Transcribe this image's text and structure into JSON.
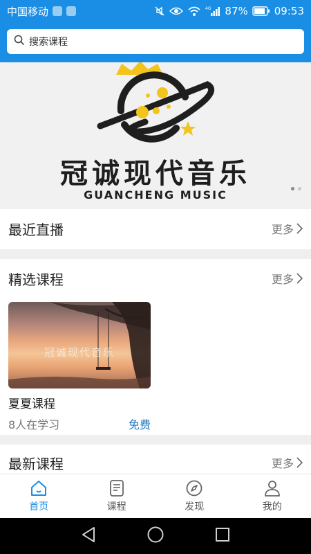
{
  "status_bar": {
    "carrier": "中国移动",
    "network": "4G",
    "battery": "87%",
    "time": "09:53"
  },
  "search": {
    "placeholder": "搜索课程"
  },
  "banner": {
    "title": "冠诚现代音乐",
    "subtitle": "GUANCHENG MUSIC",
    "page_indicator": {
      "count": 2,
      "active_index": 0
    }
  },
  "sections": {
    "live": {
      "title": "最近直播",
      "more": "更多"
    },
    "featured": {
      "title": "精选课程",
      "more": "更多",
      "courses": [
        {
          "thumb_text": "冠诚现代音乐",
          "title": "夏夏课程",
          "learners": "8人在学习",
          "price": "免费"
        }
      ]
    },
    "latest": {
      "title": "最新课程",
      "more": "更多"
    }
  },
  "tabbar": {
    "tabs": [
      {
        "label": "首页",
        "icon": "home-icon",
        "active": true
      },
      {
        "label": "课程",
        "icon": "document-icon",
        "active": false
      },
      {
        "label": "发现",
        "icon": "compass-icon",
        "active": false
      },
      {
        "label": "我的",
        "icon": "user-icon",
        "active": false
      }
    ]
  },
  "colors": {
    "primary": "#1a8ee4",
    "price": "#1b79c2",
    "banner_accent": "#f2c41c"
  }
}
